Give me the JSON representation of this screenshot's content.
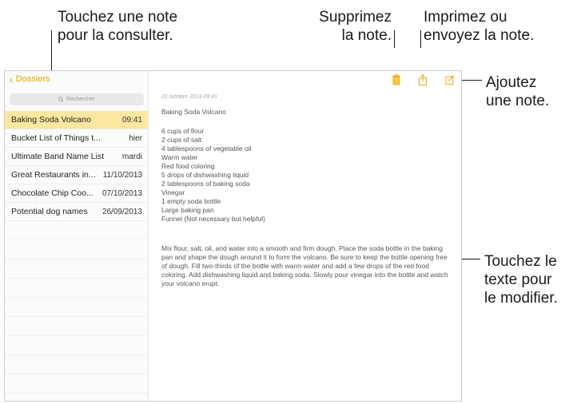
{
  "callouts": {
    "consult": [
      "Touchez une note",
      "pour la consulter."
    ],
    "delete": [
      "Supprimez",
      "la note."
    ],
    "share": [
      "Imprimez ou",
      "envoyez la note."
    ],
    "add": [
      "Ajoutez",
      "une note."
    ],
    "edit": [
      "Touchez le",
      "texte pour",
      "le modifier."
    ]
  },
  "sidebar": {
    "back_label": "Dossiers",
    "search_placeholder": "Rechercher",
    "notes": [
      {
        "title": "Baking Soda Volcano",
        "date": "09:41"
      },
      {
        "title": "Bucket List of Things t...",
        "date": "hier"
      },
      {
        "title": "Ultimate Band Name List",
        "date": "mardi"
      },
      {
        "title": "Great Restaurants in...",
        "date": "11/10/2013"
      },
      {
        "title": "Chocolate Chip Coo...",
        "date": "07/10/2013"
      },
      {
        "title": "Potential dog names",
        "date": "26/09/2013"
      }
    ]
  },
  "note": {
    "timestamp": "22 octobre 2013 09:41",
    "title": "Baking Soda Volcano",
    "ingredients": [
      "6 cups of flour",
      "2 cups of salt",
      "4 tablespoons of vegetable oil",
      "Warm water",
      "Red food coloring",
      "5 drops of dishwashing liquid",
      "2 tablespoons of baking soda",
      "Vinegar",
      "1 empty soda bottle",
      "Large baking pan",
      "Funnel (Not necessary but helpful)"
    ],
    "instructions": "Mix flour, salt, oil, and water into a smooth and firm dough.  Place the soda bottle in the baking pan and shape the dough around it to form the volcano.  Be sure to keep the bottle opening free of dough.  Fill two-thirds of the bottle with warm water and add a few drops of the red food coloring. Add dishwashing liquid and baking soda. Slowly pour vinegar into the bottle and watch your volcano erupt."
  },
  "toolbar": {
    "icons": [
      "trash-icon",
      "share-icon",
      "compose-icon"
    ]
  },
  "colors": {
    "accent": "#e6a200",
    "selected_row": "#fce7a0"
  }
}
